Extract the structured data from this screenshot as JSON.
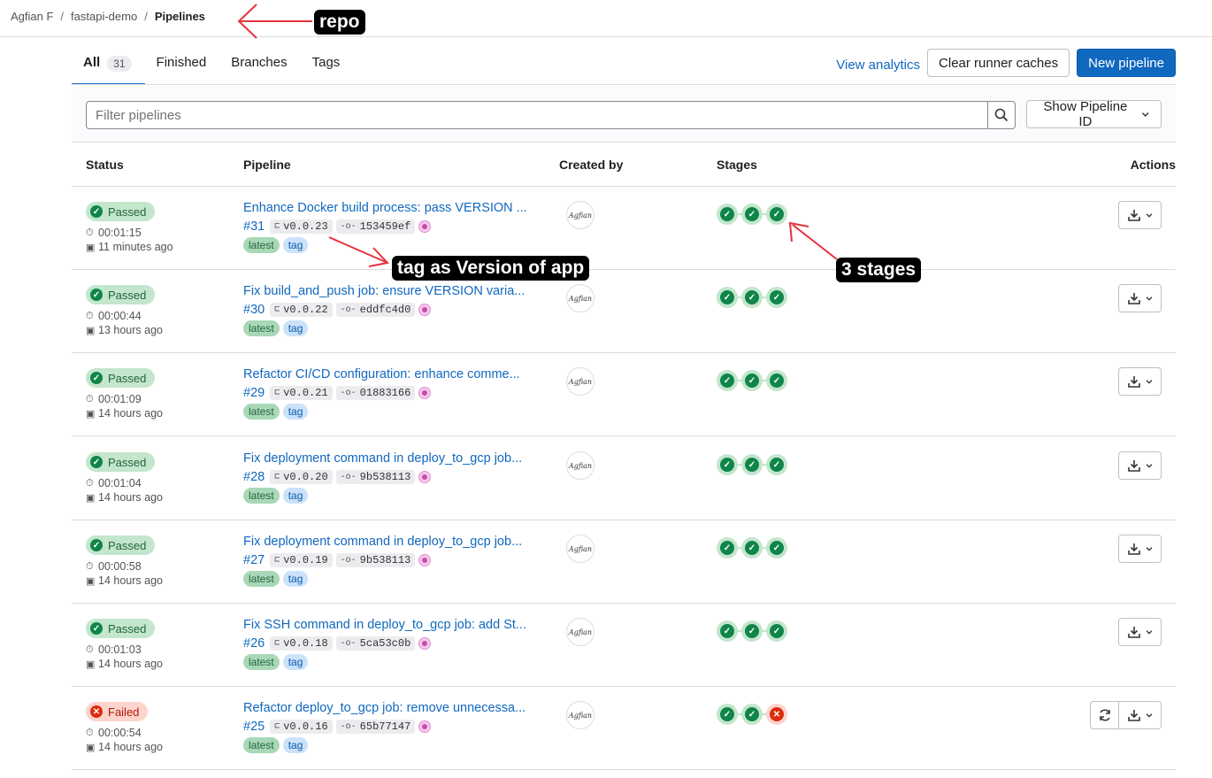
{
  "breadcrumb": [
    "Agfian F",
    "fastapi-demo",
    "Pipelines"
  ],
  "tabs": [
    {
      "label": "All",
      "count": "31"
    },
    {
      "label": "Finished"
    },
    {
      "label": "Branches"
    },
    {
      "label": "Tags"
    }
  ],
  "actions": {
    "view_analytics": "View analytics",
    "clear_caches": "Clear runner caches",
    "new_pipeline": "New pipeline"
  },
  "filter": {
    "placeholder": "Filter pipelines",
    "show_id": "Show Pipeline ID"
  },
  "table": {
    "headers": [
      "Status",
      "Pipeline",
      "Created by",
      "Stages",
      "Actions"
    ]
  },
  "rows": [
    {
      "status": "Passed",
      "duration": "00:01:15",
      "ago": "11 minutes ago",
      "title": "Enhance Docker build process: pass VERSION ...",
      "id": "#31",
      "ref": "v0.0.23",
      "sha": "153459ef",
      "labels": [
        "latest",
        "tag"
      ],
      "stages": [
        "success",
        "success",
        "success"
      ]
    },
    {
      "status": "Passed",
      "duration": "00:00:44",
      "ago": "13 hours ago",
      "title": "Fix build_and_push job: ensure VERSION varia...",
      "id": "#30",
      "ref": "v0.0.22",
      "sha": "eddfc4d0",
      "labels": [
        "latest",
        "tag"
      ],
      "stages": [
        "success",
        "success",
        "success"
      ]
    },
    {
      "status": "Passed",
      "duration": "00:01:09",
      "ago": "14 hours ago",
      "title": "Refactor CI/CD configuration: enhance comme...",
      "id": "#29",
      "ref": "v0.0.21",
      "sha": "01883166",
      "labels": [
        "latest",
        "tag"
      ],
      "stages": [
        "success",
        "success",
        "success"
      ]
    },
    {
      "status": "Passed",
      "duration": "00:01:04",
      "ago": "14 hours ago",
      "title": "Fix deployment command in deploy_to_gcp job...",
      "id": "#28",
      "ref": "v0.0.20",
      "sha": "9b538113",
      "labels": [
        "latest",
        "tag"
      ],
      "stages": [
        "success",
        "success",
        "success"
      ]
    },
    {
      "status": "Passed",
      "duration": "00:00:58",
      "ago": "14 hours ago",
      "title": "Fix deployment command in deploy_to_gcp job...",
      "id": "#27",
      "ref": "v0.0.19",
      "sha": "9b538113",
      "labels": [
        "latest",
        "tag"
      ],
      "stages": [
        "success",
        "success",
        "success"
      ]
    },
    {
      "status": "Passed",
      "duration": "00:01:03",
      "ago": "14 hours ago",
      "title": "Fix SSH command in deploy_to_gcp job: add St...",
      "id": "#26",
      "ref": "v0.0.18",
      "sha": "5ca53c0b",
      "labels": [
        "latest",
        "tag"
      ],
      "stages": [
        "success",
        "success",
        "success"
      ]
    },
    {
      "status": "Failed",
      "duration": "00:00:54",
      "ago": "14 hours ago",
      "title": "Refactor deploy_to_gcp job: remove unnecessa...",
      "id": "#25",
      "ref": "v0.0.16",
      "sha": "65b77147",
      "labels": [
        "latest",
        "tag"
      ],
      "stages": [
        "success",
        "success",
        "failed"
      ]
    }
  ],
  "annotations": {
    "repo": "repo",
    "tag_version": "tag as Version of app",
    "stages": "3 stages"
  },
  "colors": {
    "accent": "#1068bf",
    "success": "#108548",
    "failed": "#dd2b0e",
    "annotation_arrow": "#e8323c"
  }
}
